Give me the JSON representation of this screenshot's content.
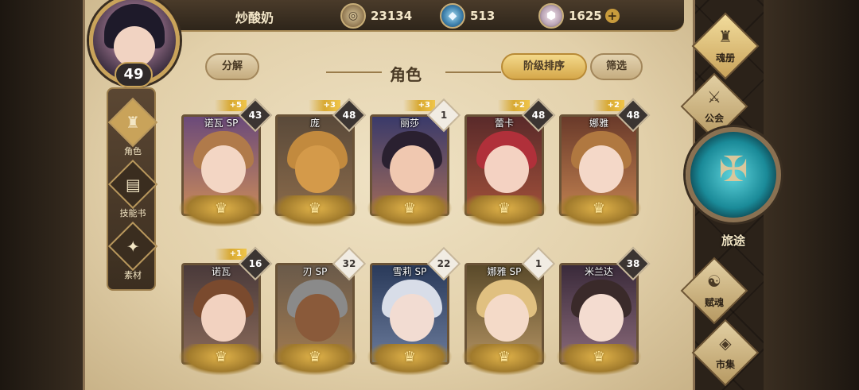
{
  "player": {
    "name": "炒酸奶",
    "level": "49"
  },
  "resources": {
    "gold": "23134",
    "crystal": "513",
    "gem": "1625",
    "plus": "+"
  },
  "left_nav": [
    {
      "label": "角色",
      "icon": "helmet-icon"
    },
    {
      "label": "技能书",
      "icon": "book-icon"
    },
    {
      "label": "素材",
      "icon": "material-icon"
    }
  ],
  "header": {
    "split": "分解",
    "title": "角色",
    "sort": "阶级排序",
    "filter": "筛选"
  },
  "cards": [
    {
      "name": "诺瓦 SP",
      "plus": "+5",
      "count": "43"
    },
    {
      "name": "庞",
      "plus": "+3",
      "count": "48"
    },
    {
      "name": "丽莎",
      "plus": "+3",
      "count": "1"
    },
    {
      "name": "蕾卡",
      "plus": "+2",
      "count": "48"
    },
    {
      "name": "娜雅",
      "plus": "+2",
      "count": "48"
    },
    {
      "name": "诺瓦",
      "plus": "+1",
      "count": "16"
    },
    {
      "name": "刃 SP",
      "plus": "",
      "count": "32"
    },
    {
      "name": "雪莉 SP",
      "plus": "",
      "count": "22"
    },
    {
      "name": "娜雅 SP",
      "plus": "",
      "count": "1"
    },
    {
      "name": "米兰达",
      "plus": "",
      "count": "38"
    }
  ],
  "right_nav": {
    "soulbook": "魂册",
    "guild": "公会",
    "journey": "旅途",
    "talent": "赋魂",
    "market": "市集"
  },
  "colors": {
    "gold_accent": "#c9a35a",
    "parchment": "#e2d0aa",
    "journey_teal": "#1a8a98"
  }
}
